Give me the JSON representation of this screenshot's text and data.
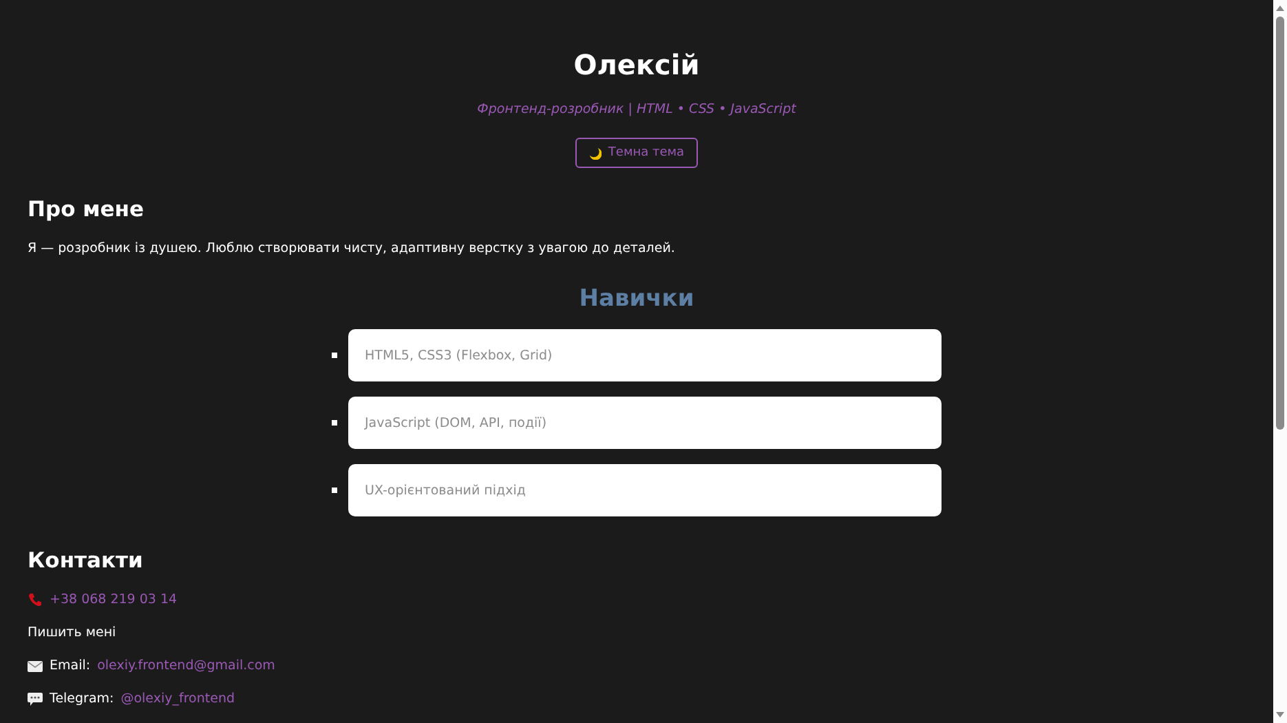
{
  "header": {
    "name": "Олексій",
    "subtitle": "Фронтенд-розробник | HTML • CSS • JavaScript",
    "theme_button": "Темна тема"
  },
  "about": {
    "heading": "Про мене",
    "text": "Я — розробник із душею. Люблю створювати чисту, адаптивну верстку з увагою до деталей."
  },
  "skills": {
    "heading": "Навички",
    "items": [
      "HTML5, CSS3 (Flexbox, Grid)",
      "JavaScript (DOM, API, події)",
      "UX-орієнтований підхід"
    ]
  },
  "contacts": {
    "heading": "Контакти",
    "items": [
      {
        "kind": "phone",
        "link": "+38 068 219 03 14"
      },
      {
        "kind": "text",
        "text": "Пишить мені"
      },
      {
        "kind": "email",
        "label": "Email:",
        "link": "olexiy.frontend@gmail.com"
      },
      {
        "kind": "telegram",
        "label": "Telegram:",
        "link": "@olexiy_frontend"
      }
    ]
  }
}
